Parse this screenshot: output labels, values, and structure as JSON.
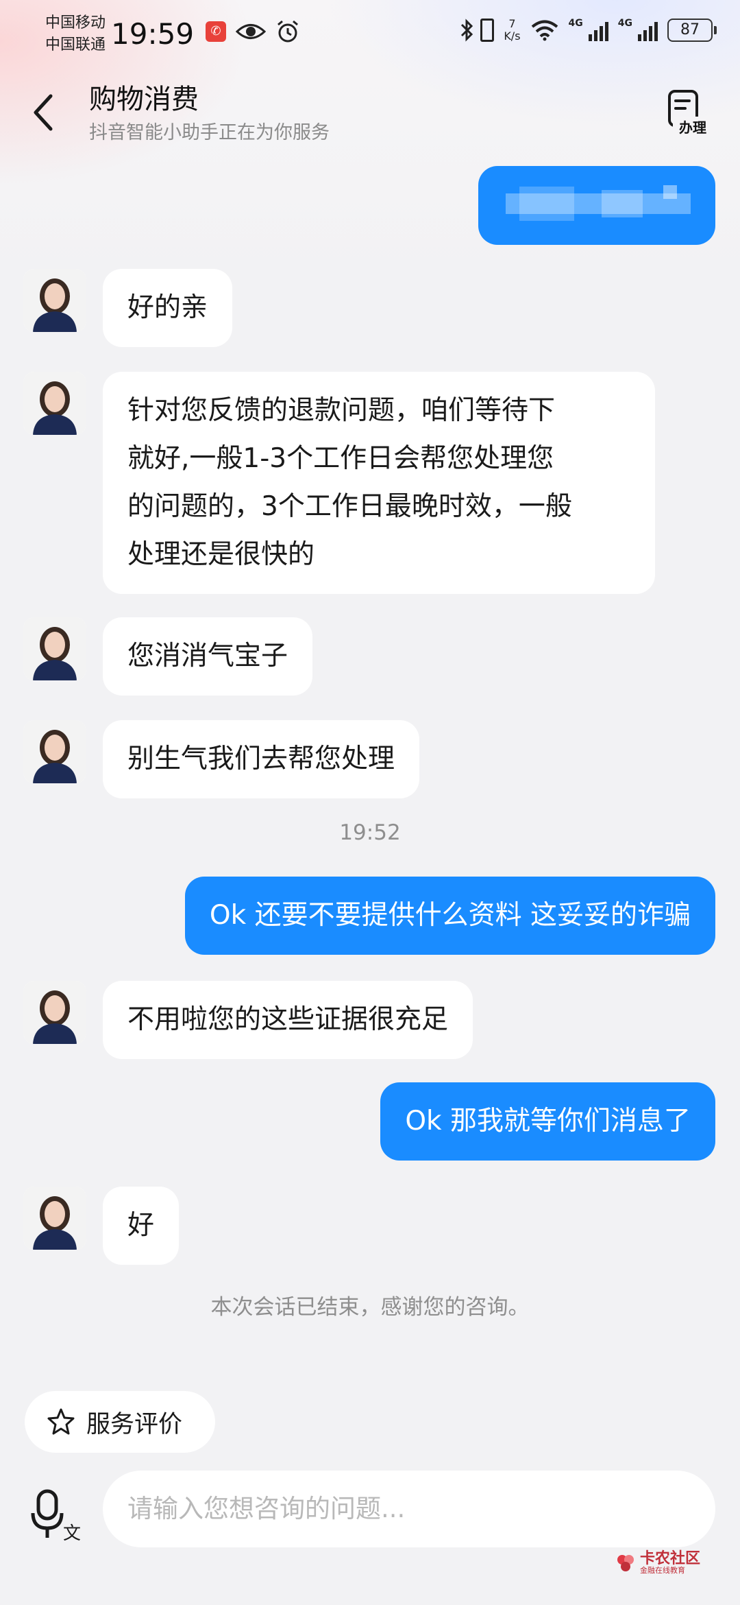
{
  "status_bar": {
    "carrier_1": "中国移动",
    "carrier_2": "中国联通",
    "time": "19:59",
    "net_speed_value": "7",
    "net_speed_unit": "K/s",
    "network_1": "4G",
    "network_2": "4G",
    "battery": "87"
  },
  "header": {
    "title": "购物消费",
    "subtitle": "抖音智能小助手正在为你服务",
    "action_label": "办理"
  },
  "messages": [
    {
      "from": "agent",
      "text": "好的亲"
    },
    {
      "from": "agent",
      "lines": [
        "针对您反馈的退款问题，咱们等待下",
        "就好,一般1-3个工作日会帮您处理您",
        "的问题的，3个工作日最晚时效，一般",
        "处理还是很快的"
      ]
    },
    {
      "from": "agent",
      "text": "您消消气宝子"
    },
    {
      "from": "agent",
      "text": "别生气我们去帮您处理"
    },
    {
      "from": "user",
      "text": "Ok 还要不要提供什么资料 这妥妥的诈骗"
    },
    {
      "from": "agent",
      "text": "不用啦您的这些证据很充足"
    },
    {
      "from": "user",
      "text": "Ok 那我就等你们消息了"
    },
    {
      "from": "agent",
      "text": "好"
    }
  ],
  "timestamp": "19:52",
  "session_ended": "本次会话已结束，感谢您的咨询。",
  "rate_button": "服务评价",
  "input": {
    "placeholder": "请输入您想咨询的问题..."
  },
  "watermark": {
    "title": "卡农社区",
    "subtitle": "金融在线教育"
  },
  "colors": {
    "user_bubble": "#1a8cff",
    "agent_bubble": "#ffffff",
    "background": "#f2f2f4"
  }
}
